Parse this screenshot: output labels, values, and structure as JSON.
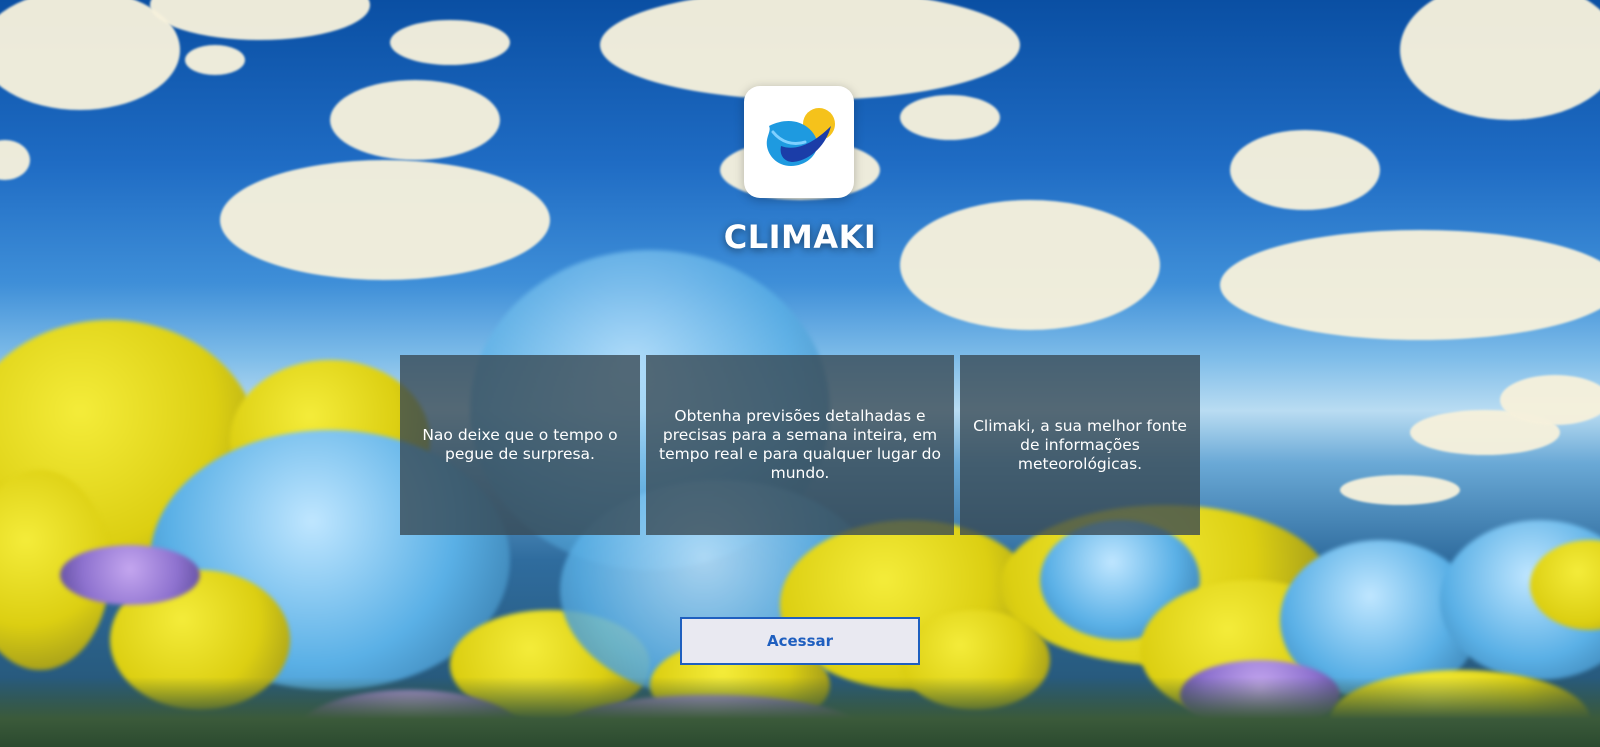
{
  "brand": {
    "title": "CLIMAKI",
    "logo_icon": "climaki-logo-icon"
  },
  "cards": [
    {
      "text": "Nao deixe que o tempo o pegue de surpresa."
    },
    {
      "text": "Obtenha previsões detalhadas e precisas para a semana inteira, em tempo real e para qualquer lugar do mundo."
    },
    {
      "text": "Climaki, a sua melhor fonte de informações meteorológicas."
    }
  ],
  "actions": {
    "access_label": "Acessar"
  },
  "colors": {
    "button_accent": "#1f5fbf",
    "card_background": "#374852",
    "logo_yellow": "#f5c21b",
    "logo_blue": "#1e9ae0"
  }
}
